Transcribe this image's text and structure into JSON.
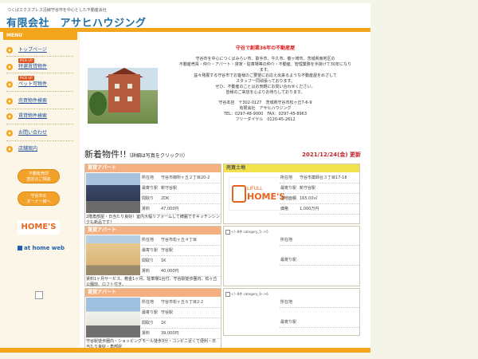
{
  "header": {
    "tagline": "つくばエクスプレス沿線守谷市を中心とした不動産会社",
    "company": "有限会社　アサヒハウジング"
  },
  "sidebar": {
    "menu_title": "MENU",
    "items": [
      {
        "label": "トップページ",
        "badge": ""
      },
      {
        "label": "特選賃貸物件",
        "badge": "PICK UP"
      },
      {
        "label": "ペット可物件",
        "badge": "PICK UP"
      },
      {
        "label": "売買物件検索",
        "badge": ""
      },
      {
        "label": "賃貸物件検索",
        "badge": ""
      },
      {
        "label": "お問い合わせ",
        "badge": ""
      },
      {
        "label": "店舗案内",
        "badge": ""
      }
    ],
    "buttons": [
      {
        "line1": "不動産売却",
        "line2": "査定のご相談"
      },
      {
        "line1": "守谷市の",
        "line2": "オーナー様へ"
      }
    ],
    "logo_homes": "HOME'S",
    "logo_athome": "at home web"
  },
  "intro": {
    "title": "守谷で創業36年の不動産屋",
    "lines": [
      "守谷市を中心につくばみらい市、取手市、牛久市、龍ヶ崎市、茨城県南地区の",
      "不動産売買・仲介・アパート・貸家・駐車場等の仲介・不動産、管理業務を手掛けて30年になり",
      "ます。",
      "益々発展する守谷市でお客様のご要望にお応え出来るような不動産屋をめざして",
      "スタッフ一同頑張っております。",
      "ぜひ、不動産のことはお気軽にお問い合わせください。",
      "皆様のご来店を心よりお待ちしております。"
    ],
    "address": "守谷本店　〒302-0127　茨城県守谷市松ヶ丘7-6-9",
    "company": "有限会社　アサヒハウジング",
    "tel_fax": "TEL：0297-48-9000　FAX：0297-45-8963",
    "freedial": "フリーダイヤル　0120-45-2612"
  },
  "listings": {
    "title": "新着物件!!",
    "subtitle": "（詳細は写真をクリック!!）",
    "date": "2021/12/24(金) 更新",
    "cards": [
      {
        "category": "賃貸アパート",
        "rows": [
          [
            "所在地",
            "守谷市御所ヶ丘２丁目20-2"
          ],
          [
            "最寄り駅",
            "新守谷駅"
          ],
          [
            "間取り",
            "2DK"
          ],
          [
            "賃料",
            "47,000円"
          ]
        ],
        "desc": "2階角部屋・日当たり良好！室内大幅リフォームして綺麗ですキッチンシンクも新品です！"
      },
      {
        "category": "売買土地",
        "rows": [
          [
            "所在地",
            "守谷市薬師台３丁目17-18"
          ],
          [
            "最寄り駅",
            "新守谷駅"
          ],
          [
            "土地面積",
            "165.00㎡"
          ],
          [
            "価格",
            "1,000万円"
          ]
        ],
        "logo_t1": "LIFULL",
        "logo_t2": "HOME'S"
      },
      {
        "category": "賃貸アパート",
        "rows": [
          [
            "所在地",
            "守谷市松ヶ丘４丁目"
          ],
          [
            "最寄り駅",
            "守谷駅"
          ],
          [
            "間取り",
            "1K"
          ],
          [
            "賃料",
            "40,000円"
          ]
        ],
        "desc": "賃料1ヶ月サービス、敷金1ヶ月、駐車場1台付、守谷駅徒歩圏内、松ヶ丘公園前、ロフト付き。"
      },
      {
        "category": "",
        "rows": [
          [
            "所在地",
            ""
          ],
          [
            "最寄り駅",
            ""
          ]
        ],
        "alt": "<!--8件 category_5-->5"
      },
      {
        "category": "賃貸アパート",
        "rows": [
          [
            "所在地",
            "守谷市松ヶ丘６丁目2-2"
          ],
          [
            "最寄り駅",
            "守谷駅"
          ],
          [
            "間取り",
            "1K"
          ],
          [
            "賃料",
            "39,000円"
          ]
        ],
        "desc": "守谷駅徒歩圏内・ショッピングモール徒歩3分・コンビニ近くて便利・日当たり良好・角部屋"
      },
      {
        "category": "",
        "rows": [
          [
            "所在地",
            ""
          ],
          [
            "最寄り駅",
            ""
          ]
        ],
        "alt": "<!--8件 category_6-->6"
      }
    ]
  },
  "colors": {
    "accent": "#f3a51b",
    "brand": "#1f6fa8",
    "date": "#c0262b"
  }
}
